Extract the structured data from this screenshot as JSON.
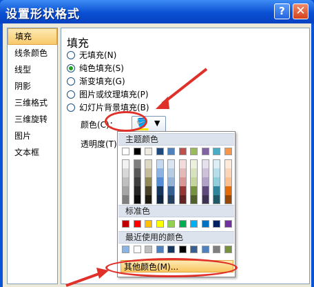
{
  "window": {
    "title": "设置形状格式",
    "help_label": "?",
    "close_label": "✕"
  },
  "nav": {
    "items": [
      {
        "label": "填充",
        "selected": true
      },
      {
        "label": "线条颜色"
      },
      {
        "label": "线型"
      },
      {
        "label": "阴影"
      },
      {
        "label": "三维格式"
      },
      {
        "label": "三维旋转"
      },
      {
        "label": "图片"
      },
      {
        "label": "文本框"
      }
    ]
  },
  "fill": {
    "heading": "填充",
    "options": [
      {
        "label": "无填充(N)",
        "checked": false
      },
      {
        "label": "纯色填充(S)",
        "checked": true
      },
      {
        "label": "渐变填充(G)",
        "checked": false
      },
      {
        "label": "图片或纹理填充(P)",
        "checked": false
      },
      {
        "label": "幻灯片背景填充(B)",
        "checked": false
      }
    ],
    "color_label": "颜色(C)：",
    "transparency_label": "透明度(T)："
  },
  "popup": {
    "theme_label": "主题颜色",
    "standard_label": "标准色",
    "recent_label": "最近使用的颜色",
    "more_colors_label": "其他颜色(M)...",
    "theme_top": [
      "#ffffff",
      "#000000",
      "#eeece1",
      "#1f497d",
      "#4f81bd",
      "#c0504d",
      "#9bbb59",
      "#8064a2",
      "#4bacc6",
      "#f79646"
    ],
    "theme_shades": [
      [
        "#f2f2f2",
        "#d8d8d8",
        "#bfbfbf",
        "#a5a5a5",
        "#7f7f7f"
      ],
      [
        "#7f7f7f",
        "#595959",
        "#3f3f3f",
        "#262626",
        "#0c0c0c"
      ],
      [
        "#ddd9c3",
        "#c4bd97",
        "#938953",
        "#494429",
        "#1d1b10"
      ],
      [
        "#c6d9f0",
        "#8db3e2",
        "#548dd4",
        "#17365d",
        "#0f243e"
      ],
      [
        "#dbe5f1",
        "#b8cce4",
        "#95b3d7",
        "#366092",
        "#244061"
      ],
      [
        "#f2dcdb",
        "#e5b9b7",
        "#d99694",
        "#953734",
        "#632423"
      ],
      [
        "#ebf1dd",
        "#d7e3bc",
        "#c3d69b",
        "#76923c",
        "#4f6128"
      ],
      [
        "#e5e0ec",
        "#ccc1d9",
        "#b2a2c7",
        "#5f497a",
        "#3f3151"
      ],
      [
        "#dbeef3",
        "#b7dde8",
        "#92cddc",
        "#31859b",
        "#205867"
      ],
      [
        "#fdeada",
        "#fbd5b5",
        "#fac08f",
        "#e36c09",
        "#974806"
      ]
    ],
    "standard": [
      "#c00000",
      "#ff0000",
      "#ffc000",
      "#ffff00",
      "#92d050",
      "#00b050",
      "#00b0f0",
      "#0070c0",
      "#002060",
      "#7030a0"
    ],
    "recent": [
      "#8db3e2",
      "#ffffff",
      "#bfbfbf",
      "#4f81bd",
      "#17365d",
      "#000000",
      "#366092",
      "#4f81bd",
      "#7f7f7f",
      "#76923c"
    ]
  },
  "annotation_color": "#e0302a"
}
